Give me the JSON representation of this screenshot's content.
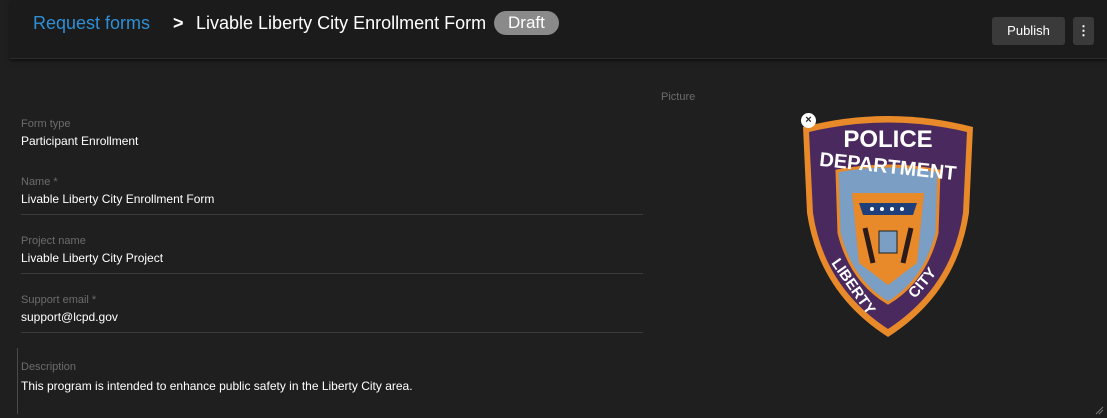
{
  "breadcrumb": {
    "parent": "Request forms",
    "separator": ">",
    "current": "Livable Liberty City Enrollment Form",
    "status": "Draft"
  },
  "toolbar": {
    "publish_label": "Publish",
    "more_icon": "more-vert-icon"
  },
  "form": {
    "form_type": {
      "label": "Form type",
      "value": "Participant Enrollment"
    },
    "name": {
      "label": "Name *",
      "value": "Livable Liberty City Enrollment Form"
    },
    "project_name": {
      "label": "Project name",
      "value": "Livable Liberty City Project"
    },
    "support_email": {
      "label": "Support email *",
      "value": "support@lcpd.gov"
    },
    "description": {
      "label": "Description",
      "value": "This program is intended to enhance public safety in the Liberty City area."
    }
  },
  "picture": {
    "label": "Picture",
    "logo_text_top": "POLICE",
    "logo_text_mid": "DEPARTMENT",
    "logo_text_left": "LIBERTY",
    "logo_text_right": "CITY"
  },
  "colors": {
    "link": "#2e8fd6",
    "badge_bg": "#8a8a8a",
    "shield_purple": "#4a2a5e",
    "shield_orange": "#e8892a",
    "shield_blue": "#7a9ec4"
  }
}
